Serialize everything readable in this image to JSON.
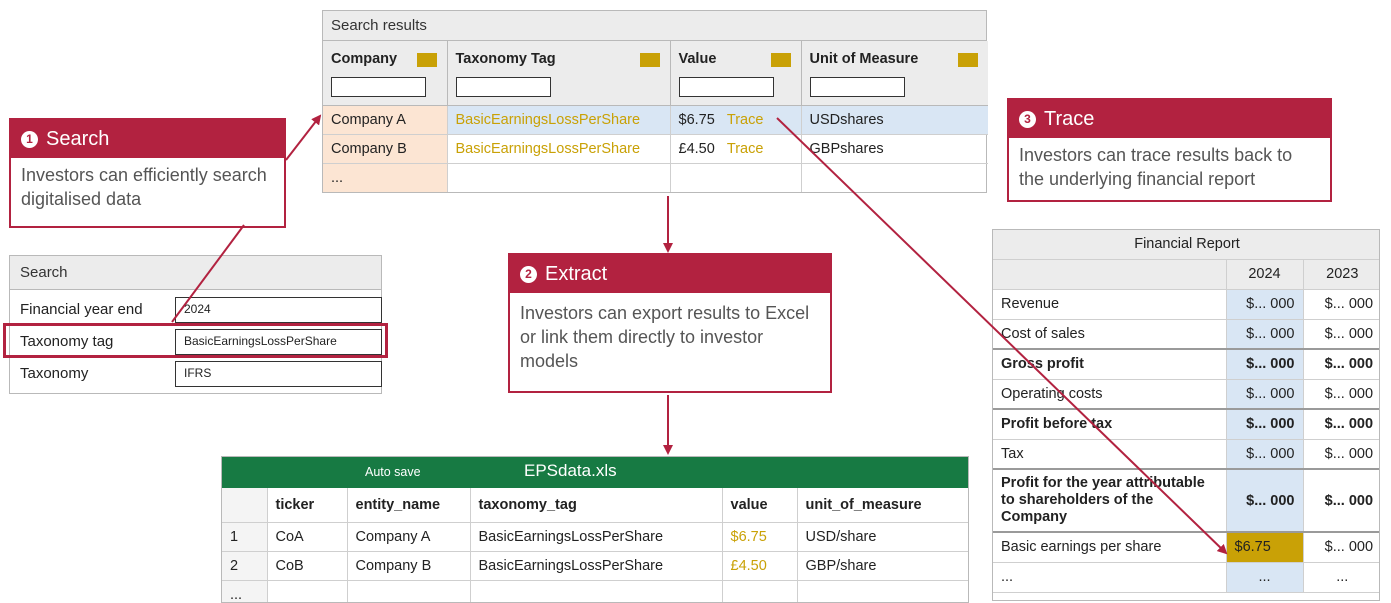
{
  "search_results": {
    "caption": "Search results",
    "columns": [
      "Company",
      "Taxonomy Tag",
      "Value",
      "Unit of Measure"
    ],
    "rows": [
      {
        "company": "Company A",
        "tag": "BasicEarningsLossPerShare",
        "value": "$6.75",
        "trace": "Trace",
        "unit": "USDshares"
      },
      {
        "company": "Company B",
        "tag": "BasicEarningsLossPerShare",
        "value": "£4.50",
        "trace": "Trace",
        "unit": "GBPshares"
      },
      {
        "company": "...",
        "tag": "",
        "value": "",
        "trace": "",
        "unit": ""
      }
    ]
  },
  "callouts": {
    "search": {
      "number": "1",
      "title": "Search",
      "body": "Investors can efficiently search digitalised data"
    },
    "extract": {
      "number": "2",
      "title": "Extract",
      "body": "Investors can export results to Excel or link them directly to investor models"
    },
    "trace": {
      "number": "3",
      "title": "Trace",
      "body": "Investors can trace results back to the underlying financial report"
    }
  },
  "search_panel": {
    "caption": "Search",
    "fields": [
      {
        "label": "Financial year end",
        "value": "2024"
      },
      {
        "label": "Taxonomy tag",
        "value": "BasicEarningsLossPerShare"
      },
      {
        "label": "Taxonomy",
        "value": "IFRS"
      }
    ]
  },
  "financial_report": {
    "title": "Financial Report",
    "years": [
      "2024",
      "2023"
    ],
    "rows": [
      {
        "label": "Revenue",
        "v2024": "$... 000",
        "v2023": "$... 000"
      },
      {
        "label": "Cost of sales",
        "v2024": "$... 000",
        "v2023": "$... 000"
      },
      {
        "label": "Gross profit",
        "v2024": "$... 000",
        "v2023": "$... 000"
      },
      {
        "label": "Operating costs",
        "v2024": "$... 000",
        "v2023": "$... 000"
      },
      {
        "label": "Profit before tax",
        "v2024": "$... 000",
        "v2023": "$... 000"
      },
      {
        "label": "Tax",
        "v2024": "$... 000",
        "v2023": "$... 000"
      },
      {
        "label": "Profit for the year attributable to shareholders of the Company",
        "v2024": "$... 000",
        "v2023": "$... 000"
      },
      {
        "label": "Basic earnings per share",
        "v2024": "$6.75",
        "v2023": "$... 000"
      },
      {
        "label": "...",
        "v2024": "...",
        "v2023": "..."
      }
    ]
  },
  "excel": {
    "autosave": "Auto save",
    "filename": "EPSdata.xls",
    "columns": [
      "ticker",
      "entity_name",
      "taxonomy_tag",
      "value",
      "unit_of_measure"
    ],
    "rows": [
      {
        "idx": "1",
        "ticker": "CoA",
        "entity_name": "Company A",
        "taxonomy_tag": "BasicEarningsLossPerShare",
        "value": "$6.75",
        "unit_of_measure": "USD/share"
      },
      {
        "idx": "2",
        "ticker": "CoB",
        "entity_name": "Company B",
        "taxonomy_tag": "BasicEarningsLossPerShare",
        "value": "£4.50",
        "unit_of_measure": "GBP/share"
      },
      {
        "idx": "...",
        "ticker": "",
        "entity_name": "",
        "taxonomy_tag": "",
        "value": "",
        "unit_of_measure": ""
      }
    ]
  },
  "colors": {
    "accent": "#b22240",
    "gold": "#c9a106",
    "excel_green": "#177a43",
    "highlight_blue": "#d9e6f4",
    "highlight_peach": "#fce5d3"
  }
}
